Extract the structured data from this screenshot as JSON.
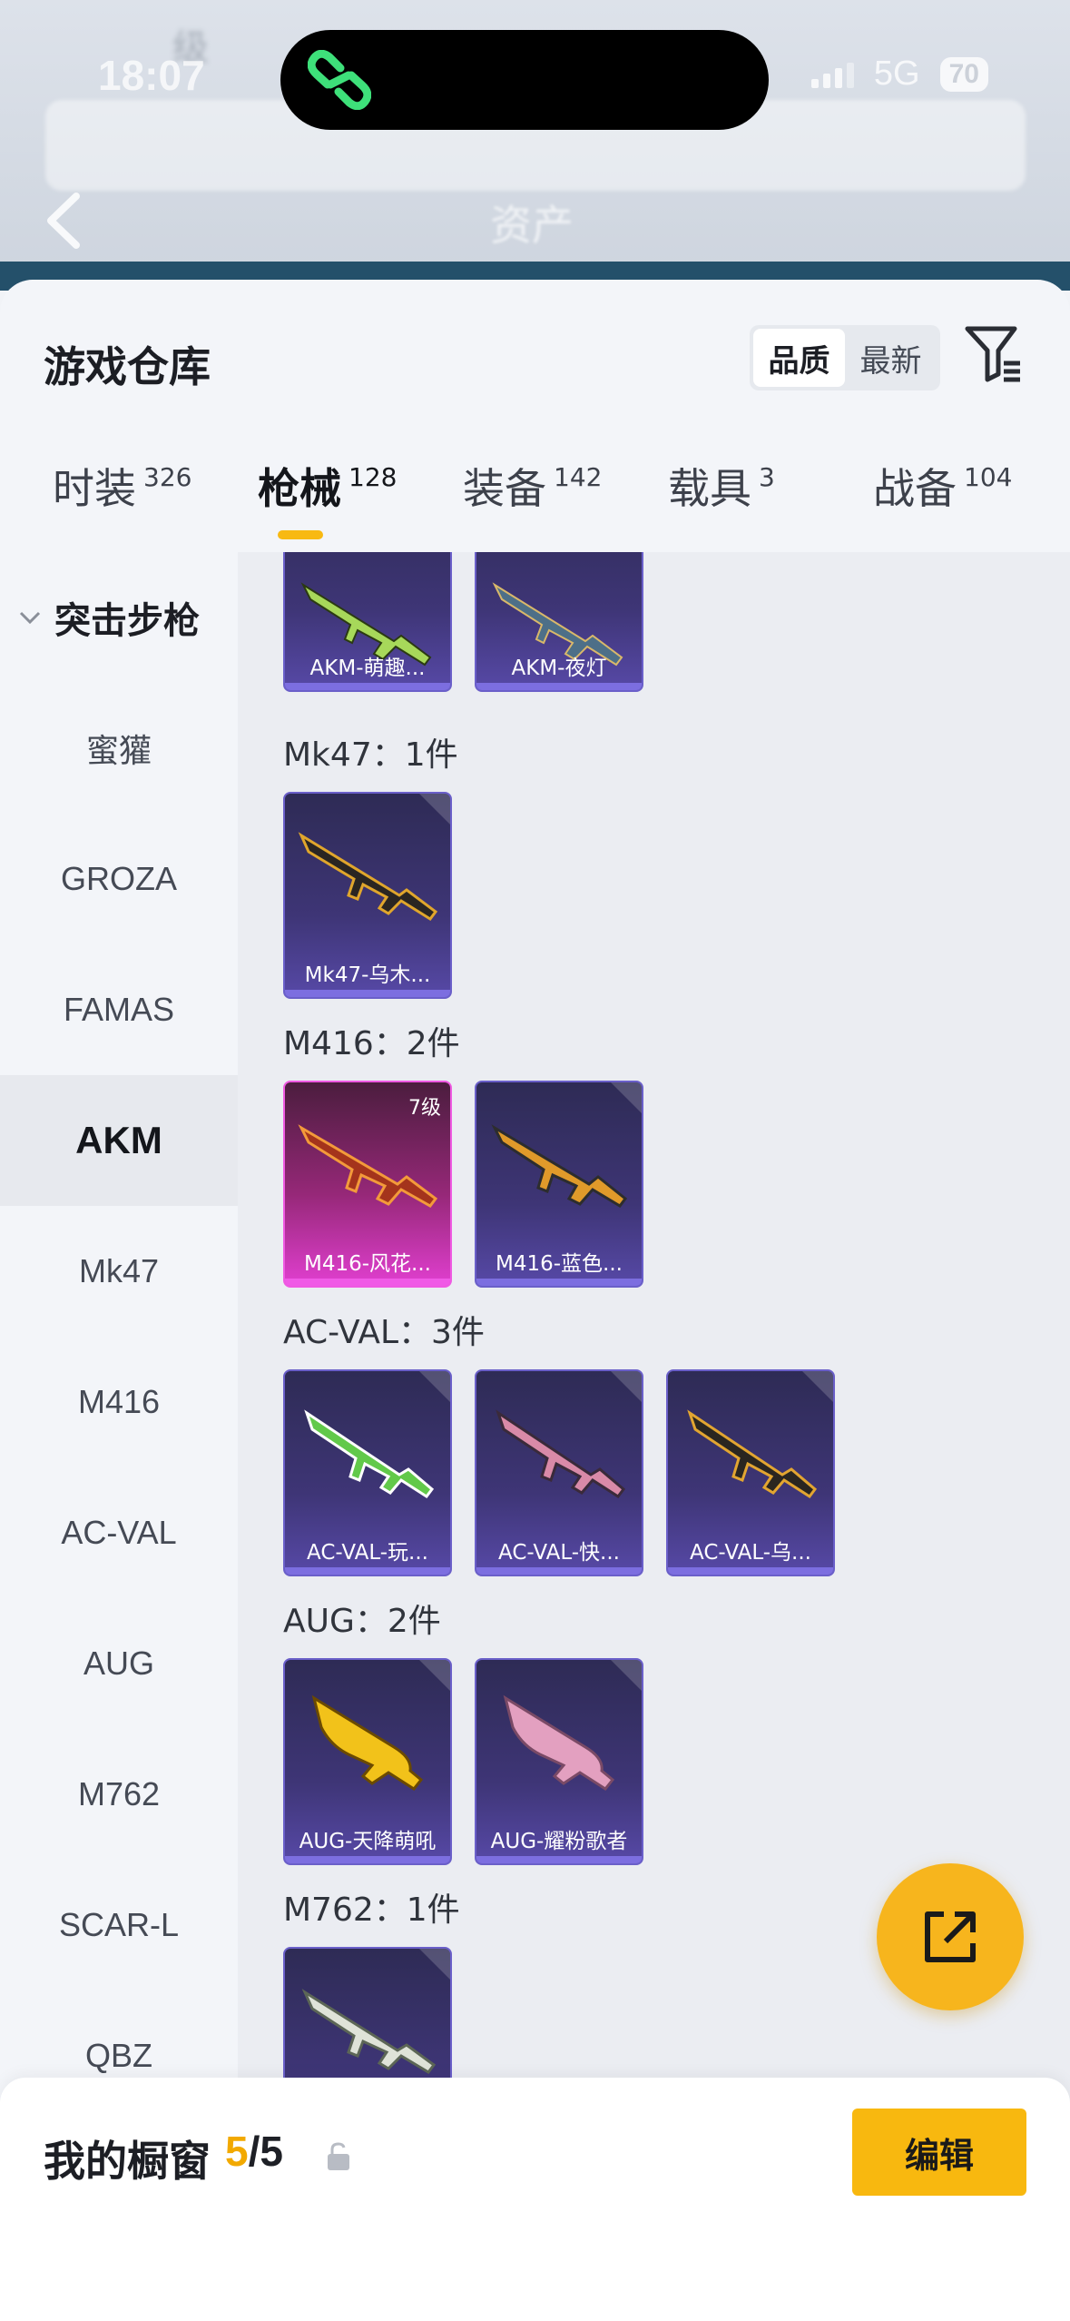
{
  "status_bar": {
    "time": "18:07",
    "network": "5G",
    "battery": "70"
  },
  "header": {
    "title": "资产",
    "ghost_rank": "级"
  },
  "sheet": {
    "title": "游戏仓库",
    "sort": {
      "quality": "品质",
      "newest": "最新"
    }
  },
  "tabs": [
    {
      "label": "时装",
      "count": "326"
    },
    {
      "label": "枪械",
      "count": "128"
    },
    {
      "label": "装备",
      "count": "142"
    },
    {
      "label": "载具",
      "count": "3"
    },
    {
      "label": "战备",
      "count": "104"
    }
  ],
  "sidebar": {
    "category": "突击步枪",
    "items": [
      "蜜獾",
      "GROZA",
      "FAMAS",
      "AKM",
      "Mk47",
      "M416",
      "AC-VAL",
      "AUG",
      "M762",
      "SCAR-L",
      "QBZ"
    ],
    "active": "AKM"
  },
  "sections": {
    "akm": {
      "items": [
        "AKM-萌趣...",
        "AKM-夜灯"
      ]
    },
    "mk47": {
      "label": "Mk47：1件",
      "items": [
        "Mk47-乌木..."
      ]
    },
    "m416": {
      "label": "M416：2件",
      "items": [
        "M416-风花...",
        "M416-蓝色..."
      ],
      "level": "7级"
    },
    "acval": {
      "label": "AC-VAL：3件",
      "items": [
        "AC-VAL-玩...",
        "AC-VAL-快...",
        "AC-VAL-乌..."
      ]
    },
    "aug": {
      "label": "AUG：2件",
      "items": [
        "AUG-天降萌吼",
        "AUG-耀粉歌者"
      ]
    },
    "m762": {
      "label": "M762：1件"
    }
  },
  "showcase": {
    "title": "我的橱窗",
    "current": "5",
    "total": "/5",
    "edit_label": "编辑"
  },
  "colors": {
    "accent": "#f8b80f",
    "card_purple": "#4a3f8f",
    "card_pink": "#e13fd0"
  },
  "icons": [
    "back-arrow-icon",
    "app-logo-icon",
    "filter-icon",
    "chevron-down-icon",
    "share-icon",
    "lock-icon"
  ]
}
